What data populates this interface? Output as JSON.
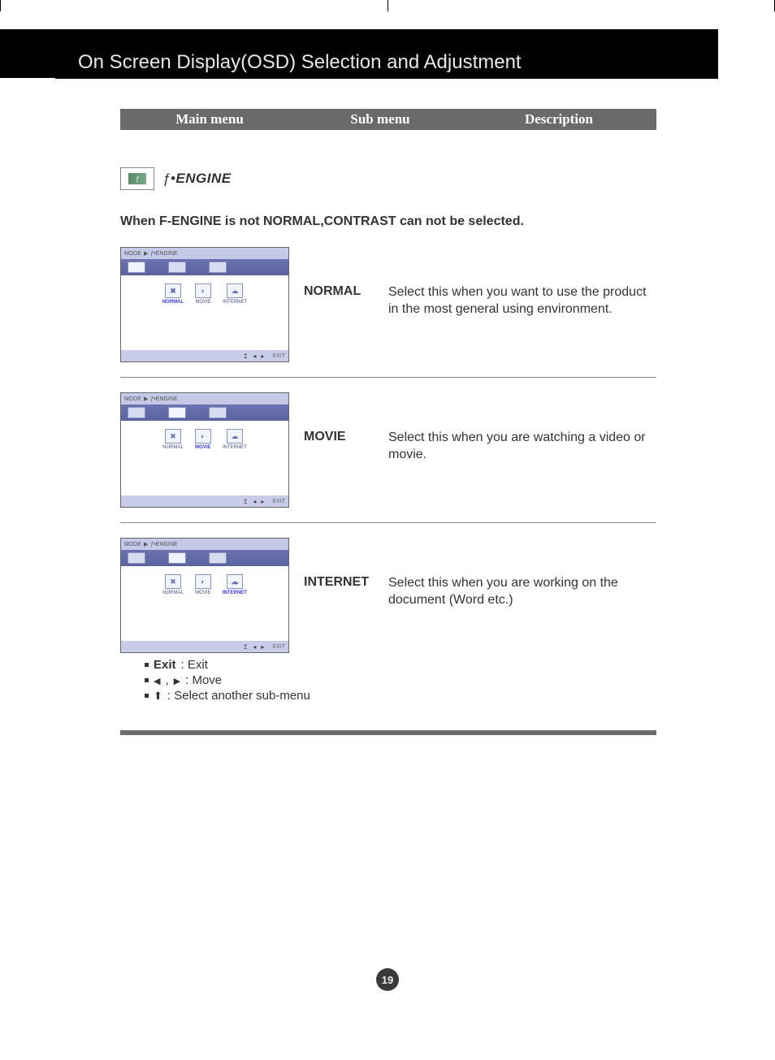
{
  "title": "On Screen Display(OSD) Selection and Adjustment",
  "header": {
    "col1": "Main menu",
    "col2": "Sub menu",
    "col3": "Description"
  },
  "engine": {
    "label": "ENGINE",
    "note": "When F-ENGINE is not NORMAL,CONTRAST can not be selected."
  },
  "osd": {
    "breadcrumb_mode": "MODE",
    "breadcrumb_engine": "ƒ•ENGINE",
    "options": [
      "NORMAL",
      "MOVIE",
      "INTERNET"
    ],
    "exit": "EXIT"
  },
  "modes": [
    {
      "name": "NORMAL",
      "desc": "Select this when you want to use the product in the most general using environment.",
      "selected_index": 0
    },
    {
      "name": "MOVIE",
      "desc": "Select this when you are watching a video or movie.",
      "selected_index": 1
    },
    {
      "name": "INTERNET",
      "desc": "Select this when you are working on the document (Word etc.)",
      "selected_index": 2
    }
  ],
  "legend": {
    "exit_label": "Exit",
    "exit_desc": ": Exit",
    "move_desc": ": Move",
    "submenu_desc": ": Select another sub-menu"
  },
  "page_number": "19"
}
